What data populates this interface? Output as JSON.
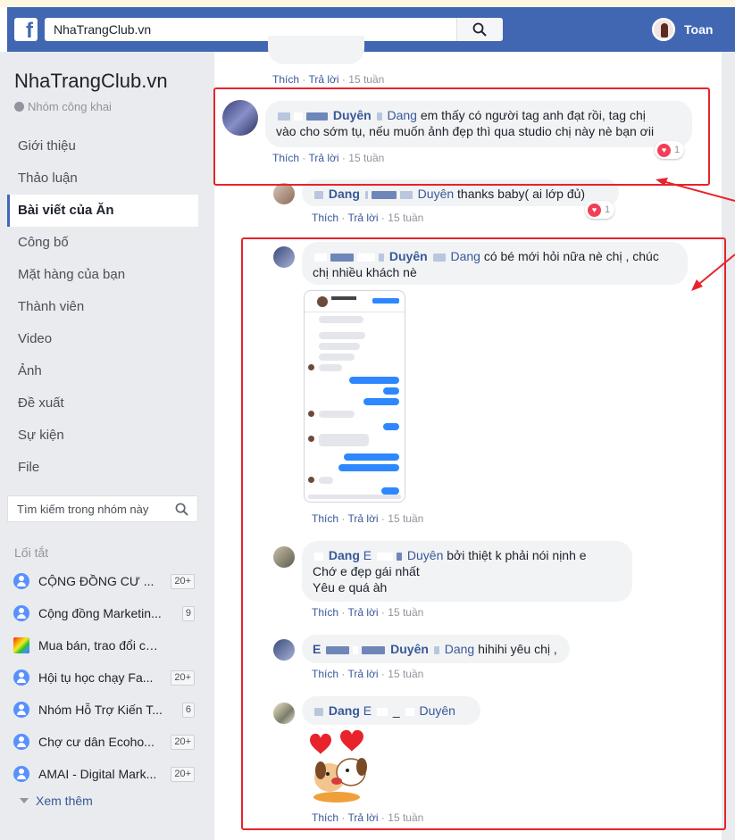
{
  "topbar": {
    "logo": "f",
    "search_value": "NhaTrangClub.vn",
    "user_name": "Toan"
  },
  "sidebar": {
    "group_name": "NhaTrangClub.vn",
    "group_type": "Nhóm công khai",
    "nav": [
      {
        "label": "Giới thiệu",
        "active": false
      },
      {
        "label": "Thảo luận",
        "active": false
      },
      {
        "label": "Bài viết của Ăn",
        "active": true
      },
      {
        "label": "Công bố",
        "active": false
      },
      {
        "label": "Mặt hàng của bạn",
        "active": false
      },
      {
        "label": "Thành viên",
        "active": false
      },
      {
        "label": "Video",
        "active": false
      },
      {
        "label": "Ảnh",
        "active": false
      },
      {
        "label": "Đề xuất",
        "active": false
      },
      {
        "label": "Sự kiện",
        "active": false
      },
      {
        "label": "File",
        "active": false
      }
    ],
    "search_placeholder": "Tìm kiếm trong nhóm này",
    "shortcuts_title": "Lối tắt",
    "shortcuts": [
      {
        "label": "CỘNG ĐỒNG CƯ ...",
        "badge": "20+",
        "icon": "group-icon"
      },
      {
        "label": "Cộng đồng Marketin...",
        "badge": "9",
        "icon": "group-icon"
      },
      {
        "label": "Mua bán, trao đổi các t...",
        "badge": "",
        "icon": "rainbow-icon"
      },
      {
        "label": "Hội tụ học chạy Fa...",
        "badge": "20+",
        "icon": "group-icon"
      },
      {
        "label": "Nhóm Hỗ Trợ Kiến T...",
        "badge": "6",
        "icon": "group-icon"
      },
      {
        "label": "Chợ cư dân Ecoho...",
        "badge": "20+",
        "icon": "group-icon"
      },
      {
        "label": "AMAI - Digital Mark...",
        "badge": "20+",
        "icon": "group-icon"
      }
    ],
    "see_more": "Xem thêm"
  },
  "feed": {
    "like": "Thích",
    "reply": "Trả lời",
    "sep": "·",
    "top_time": "15 tuần",
    "comments": [
      {
        "author": "Duyên",
        "tag": "Dang",
        "text": "em thấy có người tag anh đạt rồi, tag chị",
        "text2": "vào cho sớm tụ, nếu muốn ảnh đẹp thì qua studio chị này nè bạn ơii",
        "time": "15 tuần",
        "reactions": "1"
      },
      {
        "author": "Dang",
        "tag": "Duyên",
        "text": "thanks baby( ai lớp đủ)",
        "time": "15 tuần",
        "reactions": "1"
      },
      {
        "author": "Duyên",
        "tag": "Dang",
        "text": "có bé mới hỏi nữa nè chị , chúc",
        "text2": "chị nhiều khách nè",
        "time": "15 tuần"
      },
      {
        "author": "Dang",
        "author_suffix": "E",
        "tag": "Duyên",
        "text": "bởi thiệt k phải nói nịnh e",
        "text2": "Chớ e đẹp gái nhất",
        "text3": "Yêu e quá àh",
        "time": "15 tuần"
      },
      {
        "author_prefix": "E",
        "author": "Duyên",
        "tag": "Dang",
        "text": "hihihi yêu chị ,",
        "time": "15 tuần"
      },
      {
        "author": "Dang",
        "author_suffix": "E",
        "sep_char": "_",
        "tag": "Duyên",
        "time": "15 tuần"
      }
    ]
  },
  "colors": {
    "brand_blue": "#4267b2",
    "link": "#385898",
    "annotation_red": "#e8232b"
  }
}
